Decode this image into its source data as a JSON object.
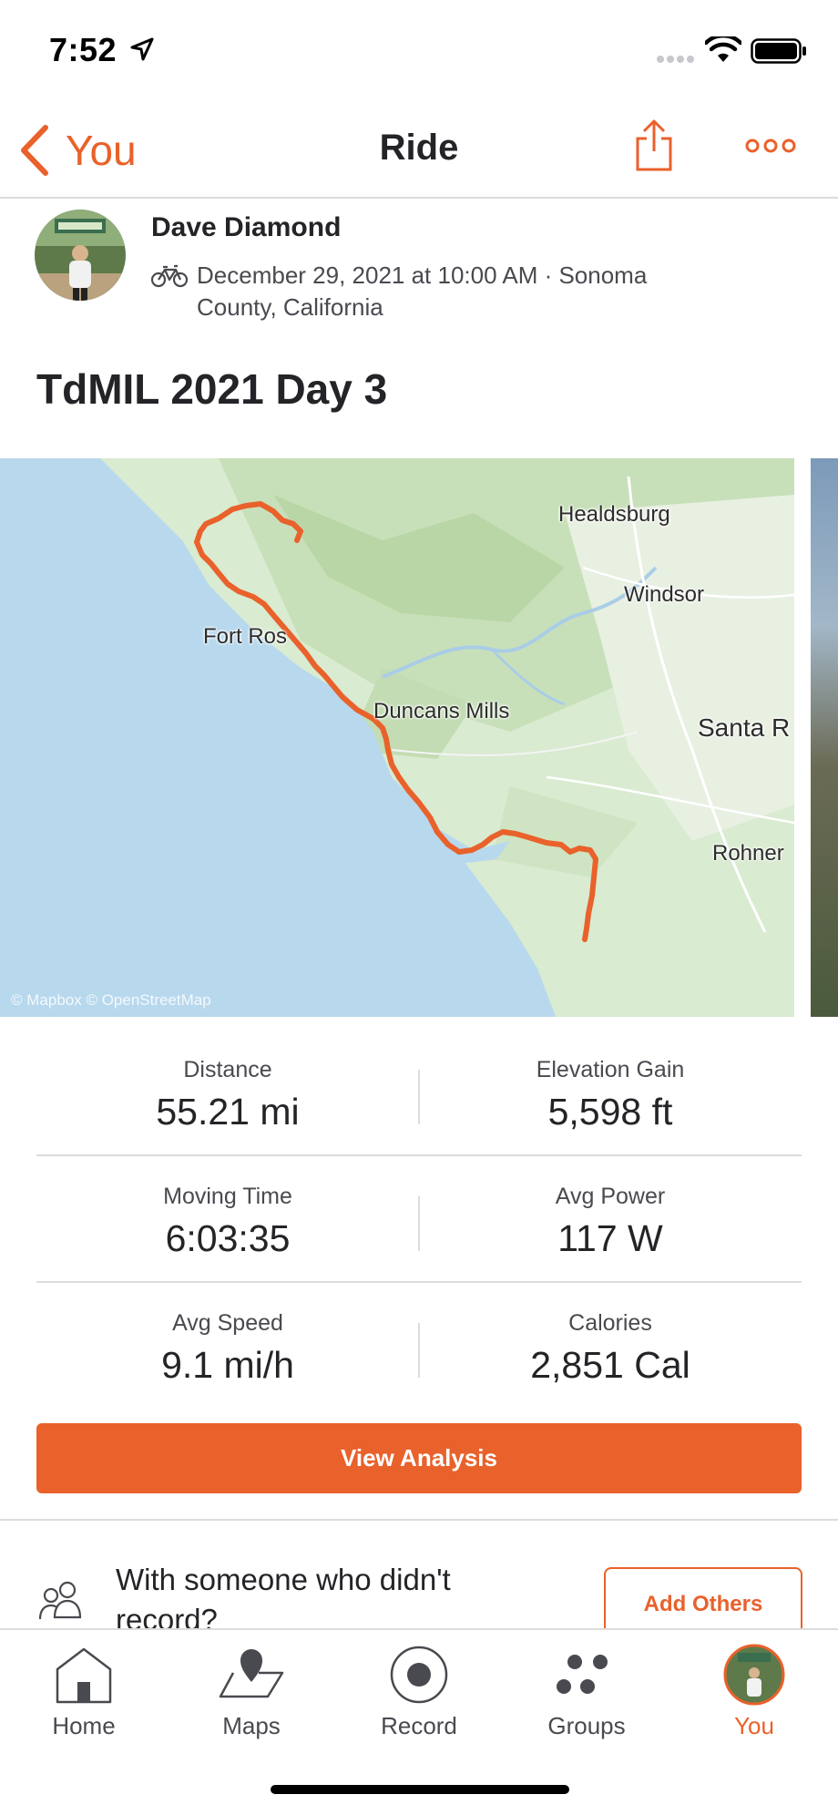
{
  "status_bar": {
    "time": "7:52"
  },
  "nav": {
    "back_label": "You",
    "title": "Ride"
  },
  "activity": {
    "athlete_name": "Dave Diamond",
    "meta": "December 29, 2021 at 10:00 AM · Sonoma County, California",
    "title": "TdMIL 2021 Day 3"
  },
  "map": {
    "labels": [
      "Healdsburg",
      "Windsor",
      "Fort Ros",
      "Duncans Mills",
      "Santa R",
      "Rohner"
    ],
    "attribution": "© Mapbox © OpenStreetMap"
  },
  "stats": [
    {
      "left": {
        "label": "Distance",
        "value": "55.21 mi"
      },
      "right": {
        "label": "Elevation Gain",
        "value": "5,598 ft"
      }
    },
    {
      "left": {
        "label": "Moving Time",
        "value": "6:03:35"
      },
      "right": {
        "label": "Avg Power",
        "value": "117 W"
      }
    },
    {
      "left": {
        "label": "Avg Speed",
        "value": "9.1 mi/h"
      },
      "right": {
        "label": "Calories",
        "value": "2,851 Cal"
      }
    }
  ],
  "actions": {
    "view_analysis": "View Analysis",
    "with_someone": "With someone who didn't record?",
    "add_others": "Add Others"
  },
  "tabs": [
    {
      "label": "Home",
      "icon": "home-icon"
    },
    {
      "label": "Maps",
      "icon": "maps-icon"
    },
    {
      "label": "Record",
      "icon": "record-icon"
    },
    {
      "label": "Groups",
      "icon": "groups-icon"
    },
    {
      "label": "You",
      "icon": "avatar",
      "active": true
    }
  ],
  "colors": {
    "accent": "#e9612b",
    "text": "#242428",
    "route": "#e9612b",
    "water": "#b8d8ee",
    "land": "#d9ebd0"
  }
}
